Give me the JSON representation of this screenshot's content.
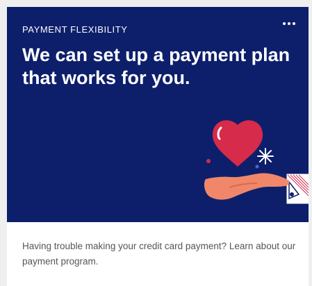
{
  "card": {
    "eyebrow": "PAYMENT FLEXIBILITY",
    "headline": "We can set up a payment plan that works for you.",
    "more_icon": "more-horizontal-icon",
    "illustration": "heart-in-hand-illustration",
    "description": "Having trouble making your credit card payment? Learn about our payment program."
  },
  "colors": {
    "hero_background": "#0d1f6b",
    "heart": "#d62b4a",
    "hand": "#f0876a",
    "text_on_dark": "#ffffff",
    "body_text": "#555555"
  }
}
